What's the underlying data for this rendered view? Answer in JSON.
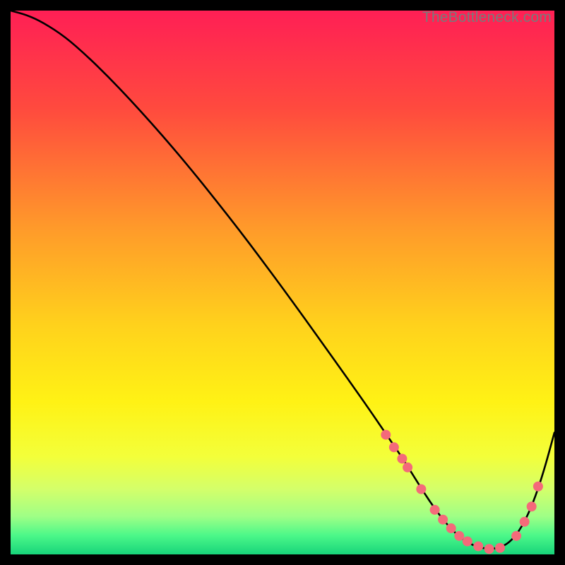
{
  "watermark": "TheBottleneck.com",
  "chart_data": {
    "type": "line",
    "title": "",
    "xlabel": "",
    "ylabel": "",
    "xlim": [
      0,
      100
    ],
    "ylim": [
      0,
      100
    ],
    "gradient_stops": [
      {
        "offset": 0.0,
        "color": "#ff1f55"
      },
      {
        "offset": 0.18,
        "color": "#ff4a3e"
      },
      {
        "offset": 0.4,
        "color": "#ff9a2a"
      },
      {
        "offset": 0.58,
        "color": "#ffd21c"
      },
      {
        "offset": 0.72,
        "color": "#fff215"
      },
      {
        "offset": 0.82,
        "color": "#f3ff3a"
      },
      {
        "offset": 0.88,
        "color": "#d4ff6a"
      },
      {
        "offset": 0.93,
        "color": "#9fff86"
      },
      {
        "offset": 0.965,
        "color": "#4cf889"
      },
      {
        "offset": 1.0,
        "color": "#17d47a"
      }
    ],
    "series": [
      {
        "name": "bottleneck-curve",
        "x": [
          0,
          3,
          6,
          10,
          14,
          18,
          22,
          26,
          30,
          34,
          38,
          42,
          46,
          50,
          54,
          58,
          62,
          66,
          69,
          72,
          74,
          76,
          78,
          80,
          82,
          84,
          86,
          88,
          90,
          92,
          94,
          96,
          98,
          100
        ],
        "y": [
          100,
          99.2,
          97.8,
          95.2,
          91.7,
          87.8,
          83.6,
          79.2,
          74.6,
          69.8,
          64.8,
          59.7,
          54.4,
          49.0,
          43.5,
          37.9,
          32.3,
          26.6,
          22.2,
          17.8,
          14.6,
          11.4,
          8.4,
          5.8,
          3.7,
          2.2,
          1.3,
          1.0,
          1.2,
          2.4,
          5.0,
          9.2,
          15.1,
          22.4
        ]
      }
    ],
    "markers": {
      "name": "highlight-dots",
      "color": "#f46a7a",
      "radius": 7,
      "points": [
        {
          "x": 69.0,
          "y": 22.0
        },
        {
          "x": 70.5,
          "y": 19.7
        },
        {
          "x": 72.0,
          "y": 17.6
        },
        {
          "x": 73.0,
          "y": 16.0
        },
        {
          "x": 75.5,
          "y": 12.0
        },
        {
          "x": 78.0,
          "y": 8.2
        },
        {
          "x": 79.5,
          "y": 6.4
        },
        {
          "x": 81.0,
          "y": 4.8
        },
        {
          "x": 82.5,
          "y": 3.4
        },
        {
          "x": 84.0,
          "y": 2.4
        },
        {
          "x": 86.0,
          "y": 1.5
        },
        {
          "x": 88.0,
          "y": 1.0
        },
        {
          "x": 90.0,
          "y": 1.2
        },
        {
          "x": 93.0,
          "y": 3.4
        },
        {
          "x": 94.5,
          "y": 6.0
        },
        {
          "x": 95.8,
          "y": 8.8
        },
        {
          "x": 97.0,
          "y": 12.5
        }
      ]
    }
  }
}
